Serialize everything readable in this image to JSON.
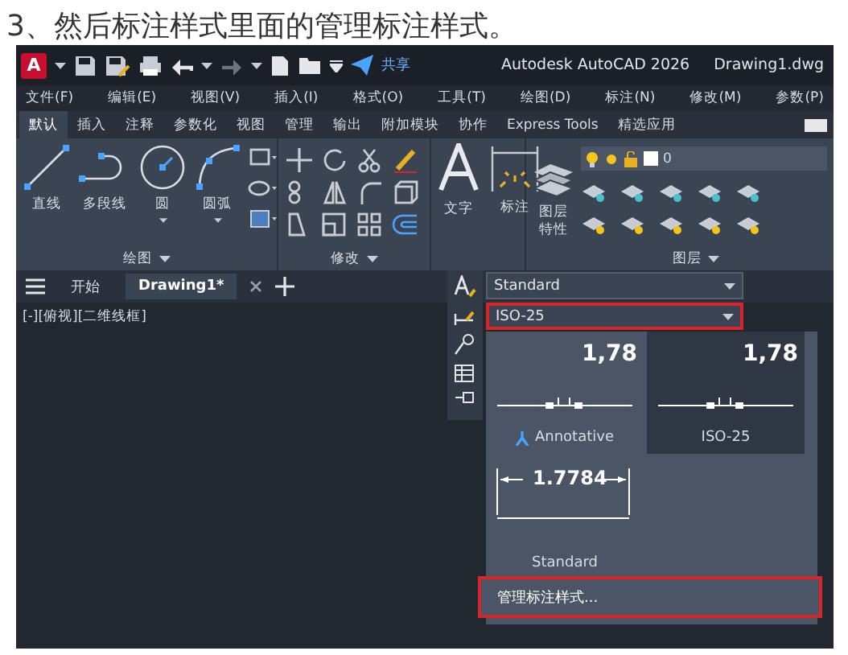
{
  "caption": "3、然后标注样式里面的管理标注样式。",
  "title_bar": {
    "logo": "A",
    "share": "共享",
    "app_title": "Autodesk AutoCAD 2026",
    "document": "Drawing1.dwg"
  },
  "menu_bar": [
    "文件(F)",
    "编辑(E)",
    "视图(V)",
    "插入(I)",
    "格式(O)",
    "工具(T)",
    "绘图(D)",
    "标注(N)",
    "修改(M)",
    "参数(P)"
  ],
  "ribbon_tabs": [
    {
      "label": "默认",
      "selected": true
    },
    {
      "label": "插入",
      "selected": false
    },
    {
      "label": "注释",
      "selected": false
    },
    {
      "label": "参数化",
      "selected": false
    },
    {
      "label": "视图",
      "selected": false
    },
    {
      "label": "管理",
      "selected": false
    },
    {
      "label": "输出",
      "selected": false
    },
    {
      "label": "附加模块",
      "selected": false
    },
    {
      "label": "协作",
      "selected": false
    },
    {
      "label": "Express Tools",
      "selected": false
    },
    {
      "label": "精选应用",
      "selected": false
    }
  ],
  "draw_panel": {
    "title": "绘图",
    "tools": [
      {
        "kind": "line",
        "label": "直线"
      },
      {
        "kind": "polyline",
        "label": "多段线"
      },
      {
        "kind": "circle",
        "label": "圆"
      },
      {
        "kind": "arc",
        "label": "圆弧"
      }
    ]
  },
  "modify_panel": {
    "title": "修改"
  },
  "annotation_panel": {
    "tools": [
      {
        "kind": "text",
        "label": "文字"
      },
      {
        "kind": "dimension",
        "label": "标注"
      }
    ]
  },
  "layers_panel": {
    "title": "图层",
    "properties_label": "图层特性",
    "current_layer": "0"
  },
  "file_tabs": [
    {
      "label": "开始",
      "selected": false
    },
    {
      "label": "Drawing1*",
      "selected": true
    }
  ],
  "viewport_label": "[-][俯视][二维线框]",
  "dim_dropdown": {
    "text_style": "Standard",
    "dim_style": "ISO-25",
    "dim_style_highlighted": true,
    "styles": [
      {
        "name": "Annotative",
        "preview": "1,78",
        "kind": "inline",
        "annotative": true,
        "selected": false
      },
      {
        "name": "ISO-25",
        "preview": "1,78",
        "kind": "inline",
        "annotative": false,
        "selected": true
      },
      {
        "name": "Standard",
        "preview": "1.7784",
        "kind": "extended",
        "annotative": false,
        "selected": false
      }
    ],
    "manage": "管理标注样式...",
    "manage_highlighted": true
  }
}
